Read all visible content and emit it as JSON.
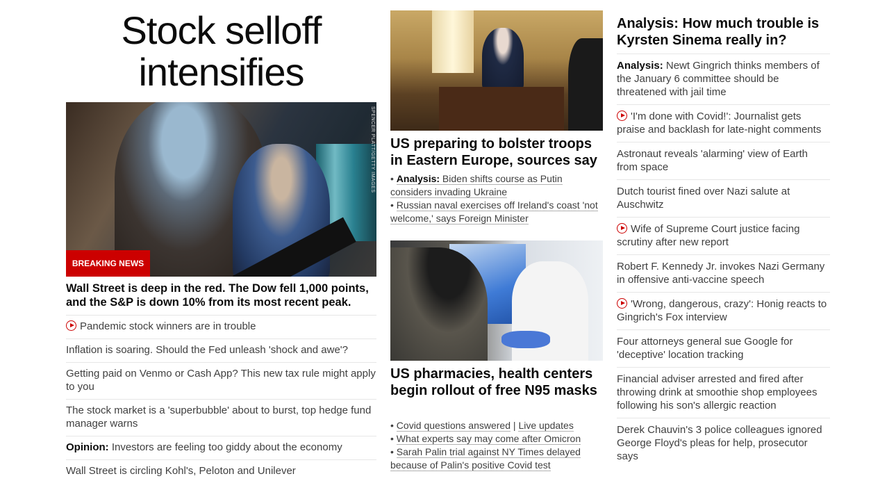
{
  "left": {
    "headline": "Stock selloff intensifies",
    "photo_credit": "SPENCER PLATT/GETTY IMAGES",
    "breaking_label": "BREAKING NEWS",
    "lead": "Wall Street is deep in the red. The Dow fell 1,000 points, and the S&P is down 10% from its most recent peak.",
    "items": [
      {
        "prefix": "",
        "text": "Pandemic stock winners are in trouble",
        "video": true
      },
      {
        "prefix": "",
        "text": "Inflation is soaring. Should the Fed unleash 'shock and awe'?",
        "video": false
      },
      {
        "prefix": "",
        "text": "Getting paid on Venmo or Cash App? This new tax rule might apply to you",
        "video": false
      },
      {
        "prefix": "",
        "text": "The stock market is a 'superbubble' about to burst, top hedge fund manager warns",
        "video": false
      },
      {
        "prefix": "Opinion:",
        "text": " Investors are feeling too giddy about the economy",
        "video": false
      },
      {
        "prefix": "",
        "text": "Wall Street is circling Kohl's, Peloton and Unilever",
        "video": false
      }
    ]
  },
  "middle": {
    "story1": {
      "headline": "US preparing to bolster troops in Eastern Europe, sources say",
      "bullets": [
        {
          "prefix": "Analysis:",
          "text": " Biden shifts course as Putin considers invading Ukraine"
        },
        {
          "prefix": "",
          "text": "Russian naval exercises off Ireland's coast 'not welcome,' says Foreign Minister"
        }
      ]
    },
    "story2": {
      "headline": "US pharmacies, health centers begin rollout of free N95 masks",
      "bullet1_a": "Covid questions answered",
      "bullet1_sep": " | ",
      "bullet1_b": "Live updates",
      "bullet2": "What experts say may come after Omicron",
      "bullet3": "Sarah Palin trial against NY Times delayed because of Palin's positive Covid test"
    }
  },
  "right": {
    "headline": "Analysis: How much trouble is Kyrsten Sinema really in?",
    "items": [
      {
        "prefix": "Analysis:",
        "text": " Newt Gingrich thinks members of the January 6 committee should be threatened with jail time",
        "video": false
      },
      {
        "prefix": "",
        "text": "'I'm done with Covid!': Journalist gets praise and backlash for late-night comments",
        "video": true
      },
      {
        "prefix": "",
        "text": "Astronaut reveals 'alarming' view of Earth from space",
        "video": false
      },
      {
        "prefix": "",
        "text": "Dutch tourist fined over Nazi salute at Auschwitz",
        "video": false
      },
      {
        "prefix": "",
        "text": "Wife of Supreme Court justice facing scrutiny after new report",
        "video": true
      },
      {
        "prefix": "",
        "text": "Robert F. Kennedy Jr. invokes Nazi Germany in offensive anti-vaccine speech",
        "video": false
      },
      {
        "prefix": "",
        "text": "'Wrong, dangerous, crazy': Honig reacts to Gingrich's Fox interview",
        "video": true
      },
      {
        "prefix": "",
        "text": "Four attorneys general sue Google for 'deceptive' location tracking",
        "video": false
      },
      {
        "prefix": "",
        "text": "Financial adviser arrested and fired after throwing drink at smoothie shop employees following his son's allergic reaction",
        "video": false
      },
      {
        "prefix": "",
        "text": "Derek Chauvin's 3 police colleagues ignored George Floyd's pleas for help, prosecutor says",
        "video": false
      }
    ]
  },
  "colors": {
    "accent": "#cc0000",
    "text": "#0c0c0c",
    "muted": "#404040"
  },
  "icons": {
    "video": "play-circle-icon"
  }
}
